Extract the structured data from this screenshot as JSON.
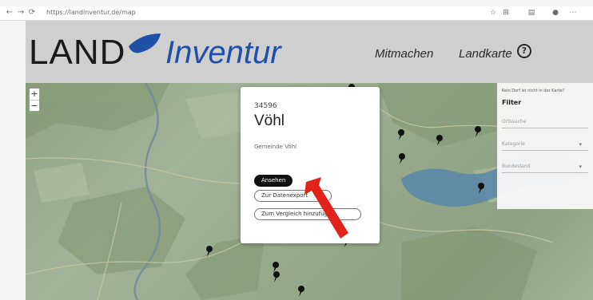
{
  "browser": {
    "url": "https://landinventur.de/map",
    "back_icon": "arrow-left-icon",
    "forward_icon": "arrow-right-icon",
    "reload_icon": "reload-icon"
  },
  "header": {
    "logo_land": "LAND",
    "logo_inventur": "Inventur",
    "nav": [
      {
        "label": "Mitmachen"
      },
      {
        "label": "Landkarte"
      }
    ],
    "help_symbol": "?",
    "brand_blue": "#1e50a8"
  },
  "map": {
    "zoom_in": "+",
    "zoom_out": "−"
  },
  "filter": {
    "hint": "Kein Dorf ist nicht in der Karte?",
    "title": "Filter",
    "search_placeholder": "Ortssuche",
    "kategorie_label": "Kategorie",
    "bundesland_label": "Bundesland",
    "chevron": "▾"
  },
  "popup": {
    "number": "34596",
    "title": "Vöhl",
    "subtitle": "Gemeinde Vöhl",
    "buttons": {
      "ansehen": "Ansehen",
      "datenexport": "Zur Datenexport",
      "vergleich": "Zum Vergleich hinzufügen"
    }
  },
  "annotation": {
    "arrow_color": "#e2231a"
  }
}
